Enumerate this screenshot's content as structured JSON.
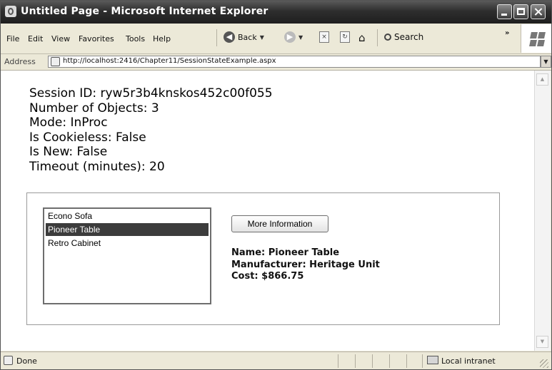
{
  "window": {
    "title": "Untitled Page - Microsoft Internet Explorer"
  },
  "menu": {
    "items": [
      "File",
      "Edit",
      "View",
      "Favorites",
      "Tools",
      "Help"
    ]
  },
  "toolbar": {
    "back_label": "Back",
    "search_label": "Search",
    "chevrons": "»"
  },
  "address": {
    "label": "Address",
    "url": "http://localhost:2416/Chapter11/SessionStateExample.aspx"
  },
  "session": {
    "lines": [
      "Session ID: ryw5r3b4knskos452c00f055",
      "Number of Objects: 3",
      "Mode: InProc",
      "Is Cookieless: False",
      "Is New: False",
      "Timeout (minutes): 20"
    ]
  },
  "products": {
    "items": [
      "Econo Sofa",
      "Pioneer Table",
      "Retro Cabinet"
    ],
    "selected_index": 1
  },
  "more_button": {
    "label": "More Information"
  },
  "details": {
    "name": "Name: Pioneer Table",
    "manufacturer": "Manufacturer: Heritage Unit",
    "cost": "Cost: $866.75"
  },
  "status": {
    "text": "Done",
    "zone": "Local intranet"
  }
}
